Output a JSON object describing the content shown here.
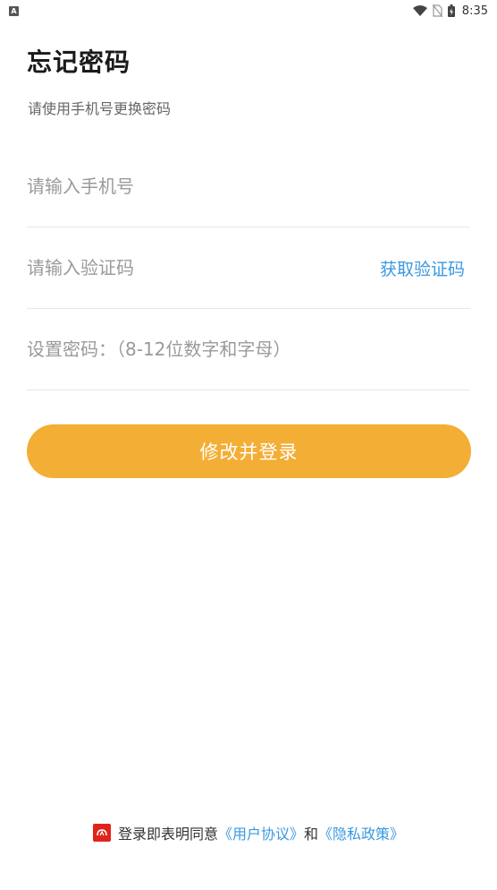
{
  "status_bar": {
    "notification_icon": "a-icon",
    "time": "8:35"
  },
  "header": {
    "title": "忘记密码",
    "subtitle": "请使用手机号更换密码"
  },
  "form": {
    "phone_placeholder": "请输入手机号",
    "code_placeholder": "请输入验证码",
    "get_code_label": "获取验证码",
    "password_placeholder": "设置密码：（8-12位数字和字母）",
    "submit_label": "修改并登录"
  },
  "agreement": {
    "prefix": "登录即表明同意",
    "user_agreement": "《用户协议》",
    "and": "和",
    "privacy_policy": "《隐私政策》"
  },
  "colors": {
    "accent": "#f3ae35",
    "link": "#3a98e0",
    "check": "#e0241c"
  }
}
